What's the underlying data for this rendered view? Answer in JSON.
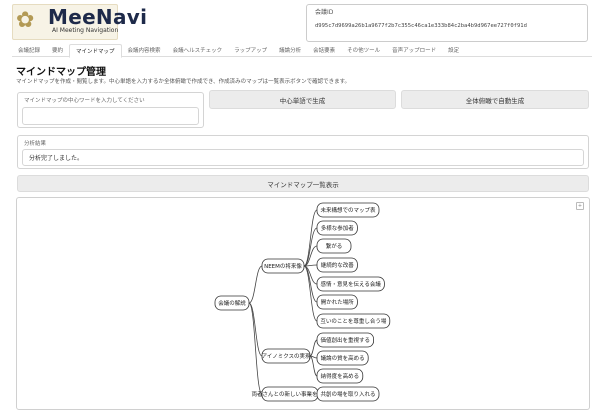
{
  "header": {
    "brand": "MeeNavi",
    "tagline": "AI Meeting Navigation",
    "meeting_label": "会議ID",
    "meeting_id": "d995c7d9699a26b1a9677f2b7c355c46ca1e333b84c2ba4b9d967ee727f0f91d"
  },
  "tabs": [
    "会議記録",
    "要約",
    "マインドマップ",
    "会議内容検索",
    "会議ヘルスチェック",
    "ラップアップ",
    "議論分析",
    "会話要素",
    "その他ツール",
    "音声アップロード",
    "設定"
  ],
  "active_tab": 2,
  "page": {
    "title": "マインドマップ管理",
    "description": "マインドマップを作成・閲覧します。中心単語を入力するか全体俯瞰で作成でき、作成済みのマップは一覧表示ボタンで確認できます。"
  },
  "center_word": {
    "label": "マインドマップの中心ワードを入力してください",
    "value": ""
  },
  "buttons": {
    "generate_center": "中心単語で生成",
    "generate_overview": "全体俯瞰で自動生成",
    "list": "マインドマップ一覧表示"
  },
  "status": {
    "label": "分析結果",
    "value": "分析完了しました。"
  },
  "mindmap": {
    "root": "会議の解説",
    "branches": [
      {
        "label": "NEEMの将来像",
        "children": [
          "未来構想でのマップ表",
          "多様な参加者",
          "繋がる",
          "継続的な改善",
          "感情・意見を伝える会議",
          "開かれた場所",
          "互いのことを尊重し合う場"
        ]
      },
      {
        "label": "アイノミクスの実現",
        "children": [
          "価値創出を重視する",
          "議論の質を高める",
          "納得度を高める"
        ]
      },
      {
        "label": "両者さんとの新しい事業を構築",
        "children": [
          "共創の場を取り入れる"
        ]
      }
    ],
    "expand_icon": "expand-icon"
  }
}
